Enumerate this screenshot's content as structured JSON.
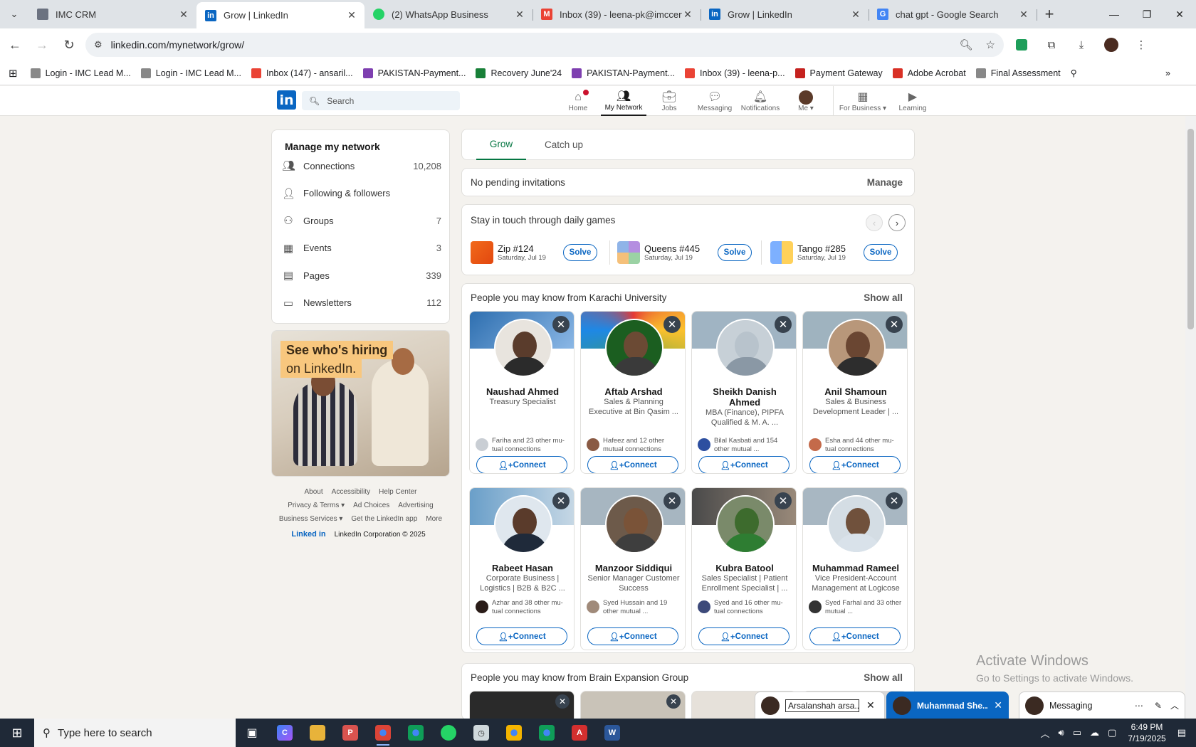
{
  "browser": {
    "tabs": [
      {
        "title": "IMC CRM",
        "fav": "crm-icon",
        "color": "#6b7280"
      },
      {
        "title": "Grow | LinkedIn",
        "fav": "linkedin-icon",
        "color": "#0a66c2"
      },
      {
        "title": "(2) WhatsApp Business",
        "fav": "whatsapp-icon",
        "color": "#25d366"
      },
      {
        "title": "Inbox (39) - leena-pk@imccerti",
        "fav": "gmail-icon",
        "color": "#ea4335"
      },
      {
        "title": "Grow | LinkedIn",
        "fav": "linkedin-icon",
        "color": "#0a66c2"
      },
      {
        "title": "chat gpt - Google Search",
        "fav": "google-icon",
        "color": "#4285f4"
      }
    ],
    "url": "linkedin.com/mynetwork/grow/",
    "bookmarks": [
      "Login - IMC Lead M...",
      "Login - IMC Lead M...",
      "Inbox (147) - ansaril...",
      "PAKISTAN-Payment...",
      "Recovery June'24",
      "PAKISTAN-Payment...",
      "Inbox (39) - leena-p...",
      "Payment Gateway",
      "Adobe Acrobat",
      "Final Assessment"
    ]
  },
  "linkedin": {
    "logo": "in",
    "search_placeholder": "Search",
    "nav": [
      {
        "label": "Home",
        "icon": "home-icon"
      },
      {
        "label": "My Network",
        "icon": "network-icon"
      },
      {
        "label": "Jobs",
        "icon": "jobs-icon"
      },
      {
        "label": "Messaging",
        "icon": "messaging-icon"
      },
      {
        "label": "Notifications",
        "icon": "bell-icon"
      },
      {
        "label": "Me ▾",
        "icon": "avatar"
      },
      {
        "label": "For Business ▾",
        "icon": "grid-icon"
      },
      {
        "label": "Learning",
        "icon": "learning-icon"
      }
    ]
  },
  "manage": {
    "title": "Manage my network",
    "items": [
      {
        "label": "Connections",
        "count": "10,208",
        "icon": "people-icon"
      },
      {
        "label": "Following & followers",
        "count": "",
        "icon": "person-icon"
      },
      {
        "label": "Groups",
        "count": "7",
        "icon": "groups-icon"
      },
      {
        "label": "Events",
        "count": "3",
        "icon": "calendar-icon"
      },
      {
        "label": "Pages",
        "count": "339",
        "icon": "building-icon"
      },
      {
        "label": "Newsletters",
        "count": "112",
        "icon": "newsletter-icon"
      }
    ]
  },
  "ad": {
    "line1": "See who's hiring",
    "line2": "on LinkedIn."
  },
  "footer": {
    "links_row1": [
      "About",
      "Accessibility",
      "Help Center"
    ],
    "links_row2": [
      "Privacy & Terms ▾",
      "Ad Choices",
      "Advertising"
    ],
    "links_row3": [
      "Business Services ▾",
      "Get the LinkedIn app",
      "More"
    ],
    "brand": "Linked in",
    "copyright": "LinkedIn Corporation © 2025"
  },
  "grow_tabs": [
    "Grow",
    "Catch up"
  ],
  "invitations": {
    "text": "No pending invitations",
    "manage": "Manage"
  },
  "games": {
    "title": "Stay in touch through daily games",
    "items": [
      {
        "name": "Zip #124",
        "date": "Saturday, Jul 19",
        "button": "Solve"
      },
      {
        "name": "Queens #445",
        "date": "Saturday, Jul 19",
        "button": "Solve"
      },
      {
        "name": "Tango #285",
        "date": "Saturday, Jul 19",
        "button": "Solve"
      }
    ]
  },
  "pymk": {
    "title": "People you may know from Karachi University",
    "show_all": "Show all",
    "connect": "Connect",
    "people": [
      {
        "name": "Naushad Ahmed",
        "headline": "Treasury Specialist",
        "mutual": "Fariha and 23 other mu-tual connections"
      },
      {
        "name": "Aftab Arshad",
        "headline": "Sales & Planning Executive at Bin Qasim ...",
        "mutual": "Hafeez and 12 other mutual connections"
      },
      {
        "name": "Sheikh Danish Ahmed",
        "headline": "MBA (Finance), PIPFA Qualified & M. A. ...",
        "mutual": "Bilal Kasbati and 154 other mutual ..."
      },
      {
        "name": "Anil Shamoun",
        "headline": "Sales & Business Development Leader | ...",
        "mutual": "Esha and 44 other mu-tual connections"
      },
      {
        "name": "Rabeet Hasan",
        "headline": "Corporate Business | Logistics | B2B & B2C ...",
        "mutual": "Azhar and 38 other mu-tual connections"
      },
      {
        "name": "Manzoor Siddiqui",
        "headline": "Senior Manager Customer Success",
        "mutual": "Syed Hussain and 19 other mutual ..."
      },
      {
        "name": "Kubra Batool",
        "headline": "Sales Specialist | Patient Enrollment Specialist | ...",
        "mutual": "Syed and 16 other mu-tual connections"
      },
      {
        "name": "Muhammad Rameel",
        "headline": "Vice President-Account Management at Logicose",
        "mutual": "Syed Farhal and 33 other mutual ..."
      }
    ]
  },
  "pymk2": {
    "title": "People you may know from Brain Expansion Group",
    "show_all": "Show all"
  },
  "activate": {
    "line1": "Activate Windows",
    "line2": "Go to Settings to activate Windows."
  },
  "messaging": {
    "chat1": "Arsalanshah arsa...",
    "chat2": "Muhammad She...",
    "main": "Messaging"
  },
  "taskbar": {
    "search_placeholder": "Type here to search",
    "time": "6:49 PM",
    "date": "7/19/2025"
  }
}
